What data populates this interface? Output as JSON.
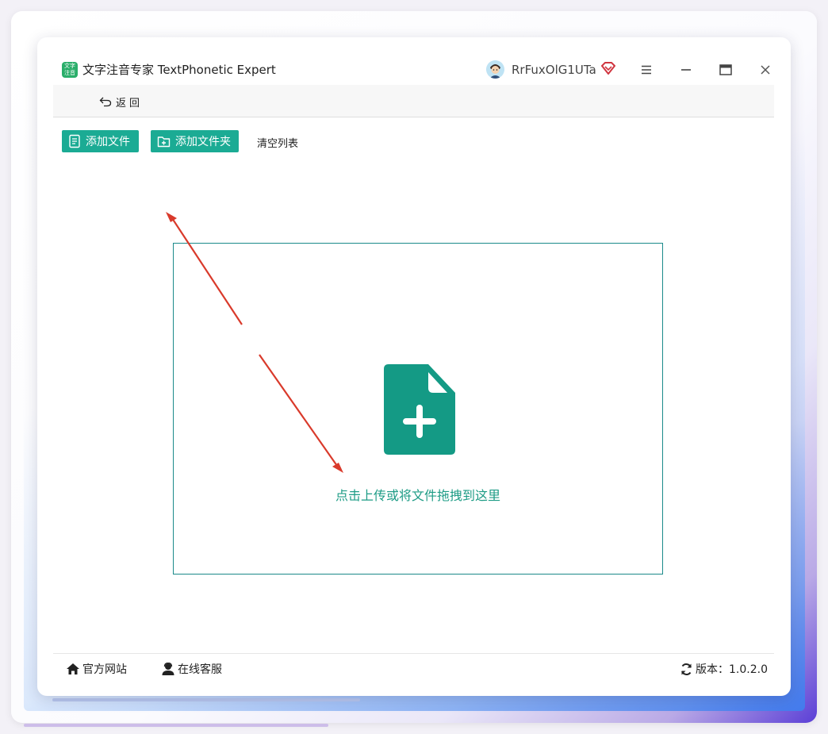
{
  "app": {
    "logo_text": "文字\n注音",
    "title": "文字注音专家 TextPhonetic Expert"
  },
  "user": {
    "name": "RrFuxOlG1UTa"
  },
  "icons": {
    "app_logo": "app-logo-icon",
    "avatar": "avatar-icon",
    "vip": "diamond-icon",
    "menu": "hamburger-icon",
    "minimize": "minimize-icon",
    "maximize": "maximize-icon",
    "close": "close-icon",
    "back": "undo-arrow-icon",
    "add_file": "document-list-icon",
    "add_folder": "folder-plus-icon",
    "dropzone": "file-plus-icon",
    "website": "home-icon",
    "support": "user-headset-icon",
    "version": "refresh-icon"
  },
  "nav": {
    "back_label": "返回"
  },
  "toolbar": {
    "add_file_label": "添加文件",
    "add_folder_label": "添加文件夹",
    "clear_list_label": "清空列表"
  },
  "dropzone": {
    "text": "点击上传或将文件拖拽到这里"
  },
  "footer": {
    "website_label": "官方网站",
    "support_label": "在线客服",
    "version_label": "版本：1.0.2.0"
  },
  "colors": {
    "accent": "#1bab94",
    "dropzone_border": "#1b8a8a",
    "drop_text": "#1e9c86",
    "file_icon": "#149a85",
    "annotation_arrow": "#d93a2b",
    "vip": "#d0353f"
  }
}
